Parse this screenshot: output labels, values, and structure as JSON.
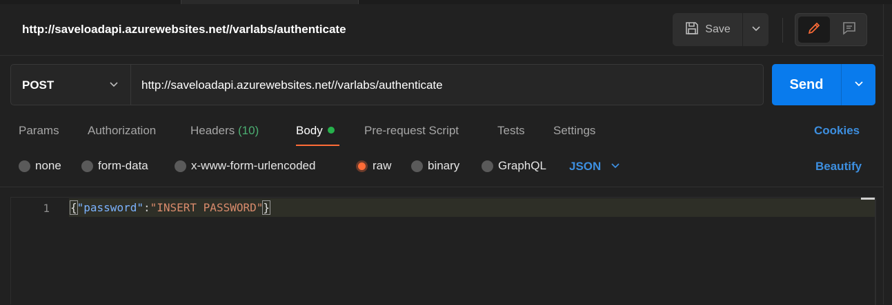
{
  "request": {
    "title": "http://saveloadapi.azurewebsites.net//varlabs/authenticate",
    "method": "POST",
    "url": "http://saveloadapi.azurewebsites.net//varlabs/authenticate"
  },
  "toolbar": {
    "save_label": "Save",
    "send_label": "Send"
  },
  "tabs": [
    {
      "label": "Params"
    },
    {
      "label": "Authorization"
    },
    {
      "label": "Headers",
      "count": "(10)"
    },
    {
      "label": "Body"
    },
    {
      "label": "Pre-request Script"
    },
    {
      "label": "Tests"
    },
    {
      "label": "Settings"
    }
  ],
  "cookies_label": "Cookies",
  "body_options": {
    "none": "none",
    "form_data": "form-data",
    "urlencoded": "x-www-form-urlencoded",
    "raw": "raw",
    "binary": "binary",
    "graphql": "GraphQL",
    "selected": "raw",
    "language": "JSON",
    "beautify": "Beautify"
  },
  "editor": {
    "line_number": "1",
    "open_brace": "{",
    "key": "\"password\"",
    "colon": ":",
    "value": "\"INSERT PASSWORD\"",
    "close_brace": "}"
  },
  "colors": {
    "accent": "#ff6c37",
    "send": "#097bed",
    "link": "#3d8fe0",
    "active_dot": "#26b14c"
  },
  "icons": [
    "save-icon",
    "chevron-down-icon",
    "pencil-icon",
    "comment-icon"
  ]
}
